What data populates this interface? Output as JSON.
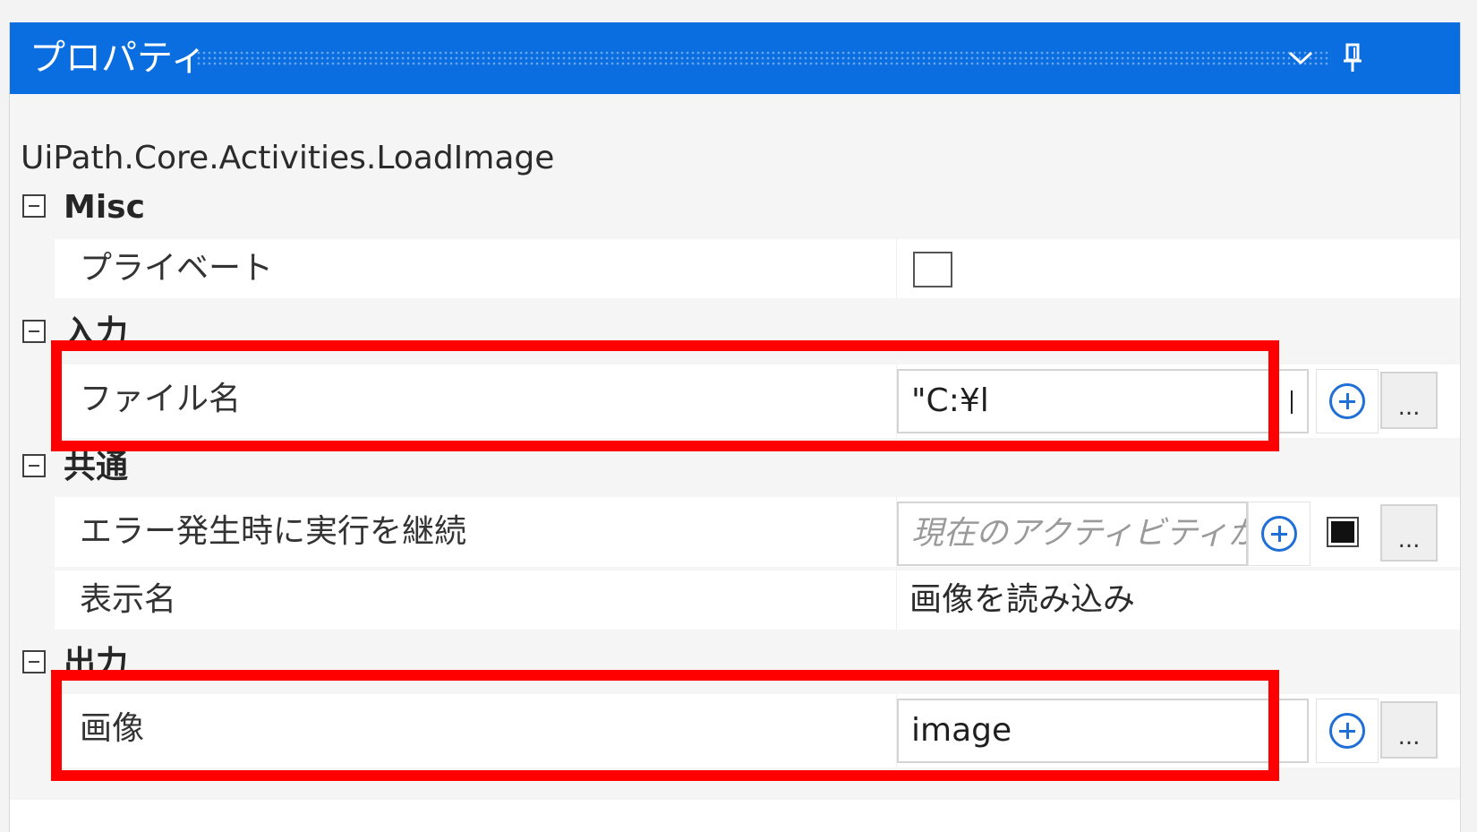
{
  "panel": {
    "title": "プロパティ",
    "activity_name": "UiPath.Core.Activities.LoadImage"
  },
  "icons": {
    "titlebar_dropdown": "chevron-down-icon",
    "titlebar_pin": "pin-icon",
    "category_toggle": "collapse-minus-icon",
    "add_variable": "circle-plus-icon",
    "browse": "ellipsis-icon"
  },
  "categories": {
    "misc": {
      "label": "Misc",
      "props": {
        "private": {
          "label": "プライベート",
          "checked": false
        }
      }
    },
    "input": {
      "label": "入力",
      "props": {
        "filename": {
          "label": "ファイル名",
          "value": "\"C:¥l"
        }
      }
    },
    "common": {
      "label": "共通",
      "props": {
        "continue_on_error": {
          "label": "エラー発生時に実行を継続",
          "placeholder": "現在のアクティビティが"
        },
        "display_name": {
          "label": "表示名",
          "value": "画像を読み込み"
        }
      }
    },
    "output": {
      "label": "出力",
      "props": {
        "image": {
          "label": "画像",
          "value": "image"
        }
      }
    }
  },
  "buttons": {
    "browse_label": "..."
  },
  "colors": {
    "title_bar": "#0a6de0",
    "highlight": "#ff0000",
    "accent_plus": "#1f6fd6"
  }
}
